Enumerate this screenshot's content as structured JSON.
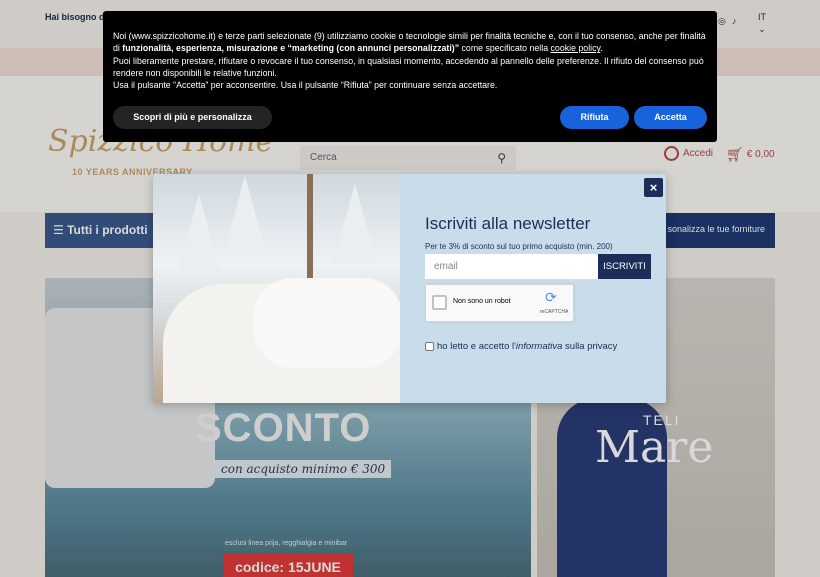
{
  "topbar": {
    "help_text": "Hai bisogno di",
    "socials": [
      "instagram-icon",
      "tiktok-icon"
    ],
    "language": "IT"
  },
  "header": {
    "logo_text": "Spizzico Home",
    "logo_sub": "10 YEARS ANNIVERSARY",
    "search_placeholder": "Cerca",
    "account_label": "Accedi",
    "cart_total": "€ 0,00"
  },
  "nav": {
    "all_products": "Tutti i prodotti",
    "right_link": "sonalizza le tue forniture"
  },
  "hero_left": {
    "headline": "SCONTO",
    "subline": "con acquisto minimo € 300",
    "exclusions": "esclusi linea prija, regghialgia e minibar",
    "code": "codice: 15JUNE"
  },
  "hero_right": {
    "label_top": "TELI",
    "label_main": "Mare"
  },
  "cookie_banner": {
    "p1_start": "Noi (www.spizzicohome.it) e terze parti selezionate (9) utilizziamo cookie o tecnologie simili per finalità tecniche e, con il tuo consenso, anche per finalità di ",
    "p1_bold": "funzionalità, esperienza, misurazione e “marketing (con annunci personalizzati)”",
    "p1_mid": " come specificato nella ",
    "p1_link": "cookie policy",
    "p1_end": ".",
    "p2": "Puoi liberamente prestare, rifiutare o revocare il tuo consenso, in qualsiasi momento, accedendo al pannello delle preferenze. Il rifiuto del consenso può rendere non disponibili le relative funzioni.",
    "p3": "Usa il pulsante “Accetta” per acconsentire. Usa il pulsante “Rifiuta” per continuare senza accettare.",
    "more_button": "Scopri di più e personalizza",
    "reject_button": "Rifiuta",
    "accept_button": "Accetta"
  },
  "newsletter": {
    "close_label": "×",
    "title": "Iscriviti alla newsletter",
    "subtitle": "Per te 3% di sconto sul tuo primo acquisto (min. 200)",
    "email_placeholder": "email",
    "subscribe_button": "ISCRIVITI",
    "captcha_label": "Non sono un robot",
    "captcha_brand": "reCAPTCHA",
    "privacy_start": "ho letto e accetto l'",
    "privacy_link": "informativa",
    "privacy_end": " sulla privacy"
  }
}
